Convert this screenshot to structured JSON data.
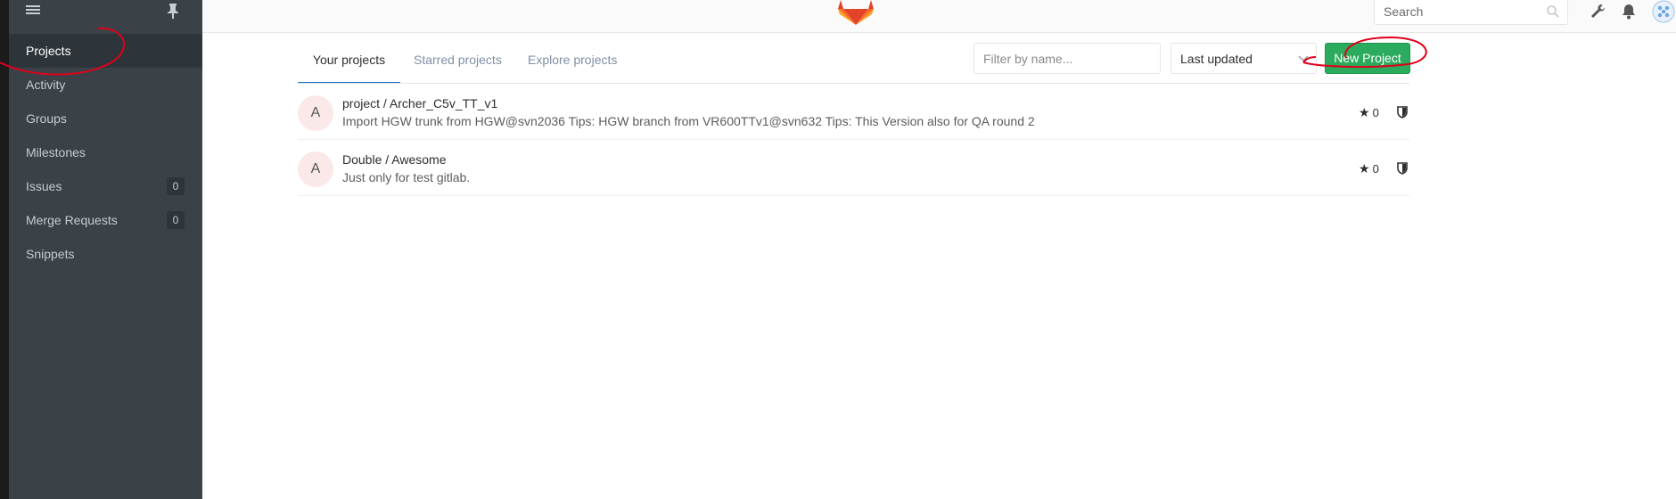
{
  "sidebar": {
    "items": [
      {
        "label": "Projects",
        "active": true
      },
      {
        "label": "Activity"
      },
      {
        "label": "Groups"
      },
      {
        "label": "Milestones"
      },
      {
        "label": "Issues",
        "count": "0"
      },
      {
        "label": "Merge Requests",
        "count": "0"
      },
      {
        "label": "Snippets"
      }
    ]
  },
  "header": {
    "search_placeholder": "Search"
  },
  "main": {
    "tabs": [
      {
        "label": "Your projects",
        "active": true
      },
      {
        "label": "Starred projects"
      },
      {
        "label": "Explore projects"
      }
    ],
    "filter_placeholder": "Filter by name...",
    "sort_selected": "Last updated",
    "new_project_label": "New Project",
    "projects": [
      {
        "avatar": "A",
        "title": "project / Archer_C5v_TT_v1",
        "description": "Import HGW trunk from HGW@svn2036 Tips: HGW branch from VR600TTv1@svn632 Tips: This Version also for QA round 2",
        "stars": "0"
      },
      {
        "avatar": "A",
        "title": "Double / Awesome",
        "description": "Just only for test gitlab.",
        "stars": "0"
      }
    ]
  },
  "colors": {
    "sidebar_bg": "#3a4248",
    "accent_blue": "#1f78d1",
    "new_project_green": "#2bab5e",
    "annotation_red": "#e0001b"
  },
  "icons": [
    "hamburger-icon",
    "pin-icon",
    "gitlab-logo",
    "search-icon",
    "wrench-icon",
    "bell-icon",
    "user-avatar-icon",
    "star-icon",
    "shield-icon",
    "chevron-down-icon"
  ]
}
